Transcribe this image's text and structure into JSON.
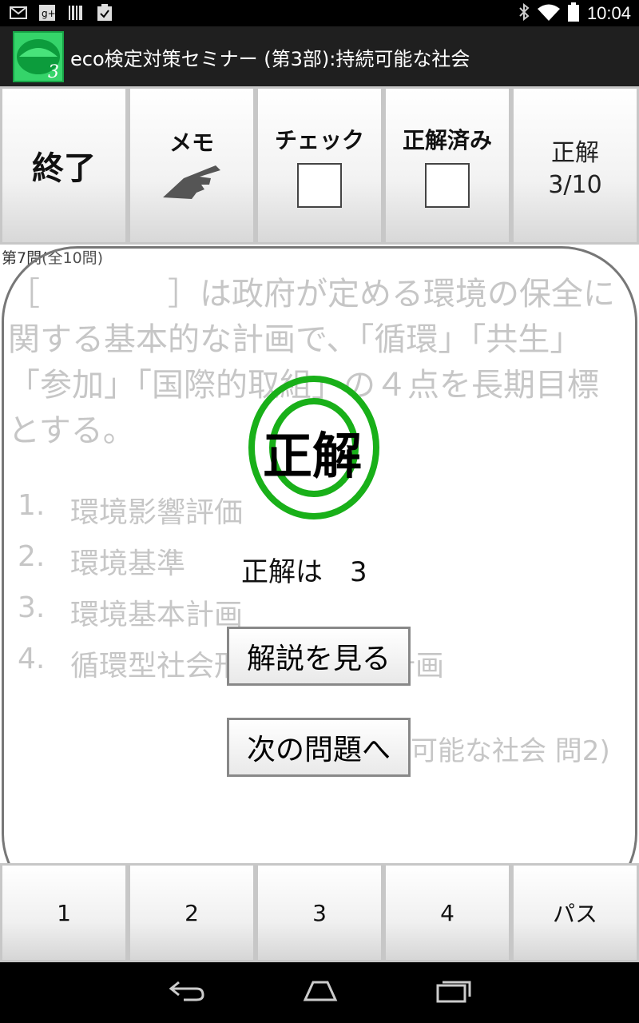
{
  "status_bar": {
    "time": "10:04",
    "left_icons": [
      "mail-icon",
      "google-plus-icon",
      "barcode-icon",
      "clipboard-check-icon"
    ],
    "right_icons": [
      "bluetooth-icon",
      "wifi-icon",
      "battery-icon"
    ]
  },
  "app": {
    "title": "eco検定対策セミナー (第3部):持続可能な社会",
    "icon_number": "3"
  },
  "toolbar": {
    "quit": "終了",
    "memo": "メモ",
    "check": "チェック",
    "answered": "正解済み",
    "score_label": "正解",
    "score_value": "3/10"
  },
  "question": {
    "number": "第7問(全10問)",
    "text": "［　　　　］は政府が定める環境の保全に関する基本的な計画で、「循環」「共生」「参加」「国際的取組」の４点を長期目標とする。",
    "choices": [
      {
        "num": "1.",
        "text": "環境影響評価"
      },
      {
        "num": "2.",
        "text": "環境基準"
      },
      {
        "num": "3.",
        "text": "環境基本計画"
      },
      {
        "num": "4.",
        "text": "循環型社会形成推進基本計画"
      }
    ],
    "source": "可能な社会 問2)"
  },
  "result": {
    "stamp": "正解",
    "answer": "正解は　3",
    "explain_button": "解説を見る",
    "next_button": "次の問題へ",
    "stamp_color": "#19b019"
  },
  "answer_buttons": [
    "1",
    "2",
    "3",
    "4",
    "パス"
  ]
}
